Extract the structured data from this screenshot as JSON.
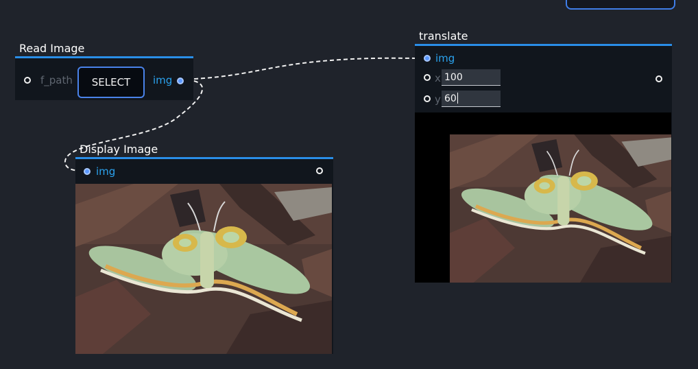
{
  "nodes": {
    "read_image": {
      "title": "Read Image",
      "input_label": "f_path",
      "button_label": "SELECT",
      "output_label": "img"
    },
    "display_image": {
      "title": "Display Image",
      "input_label": "img"
    },
    "translate": {
      "title": "translate",
      "input_label": "img",
      "x_label": "x",
      "x_value": "100",
      "y_label": "y",
      "y_value": "60"
    }
  },
  "colors": {
    "canvas": "#1f232b",
    "node_body": "#11161d",
    "accent": "#2a8ee8",
    "port_label": "#2ba3ef",
    "connection": "#f2f2f2"
  },
  "icons": {
    "port": "circle",
    "connected_port": "filled-circle",
    "image_preview": "moth-photo"
  }
}
